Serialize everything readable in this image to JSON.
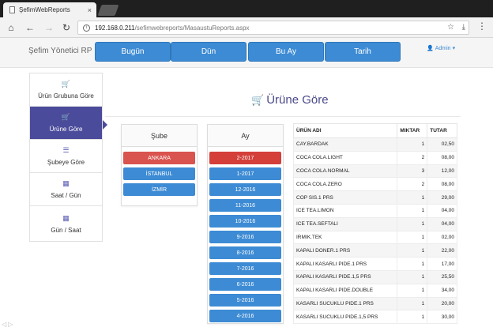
{
  "browser": {
    "tab_title": "ŞefimWebReports",
    "tab_close": "×",
    "url_host": "192.168.0.211",
    "url_path": "/sefimwebreports/MasaustuReports.aspx"
  },
  "navbar": {
    "brand": "Şefim Yönetici RP",
    "buttons": [
      "Bugün",
      "Dün",
      "Bu Ay",
      "Tarih"
    ],
    "user": "Admin"
  },
  "sidebar": {
    "items": [
      {
        "label": "Ürün Grubuna Göre",
        "icon": "cart-icon"
      },
      {
        "label": "Ürüne Göre",
        "icon": "cart-icon",
        "active": true
      },
      {
        "label": "Şubeye Göre",
        "icon": "list-icon"
      },
      {
        "label": "Saat / Gün",
        "icon": "calendar-icon"
      },
      {
        "label": "Gün / Saat",
        "icon": "calendar-icon"
      }
    ]
  },
  "page": {
    "title": "Ürüne Göre"
  },
  "sube_panel": {
    "header": "Şube",
    "items": [
      "ANKARA",
      "İSTANBUL",
      "İZMİR"
    ]
  },
  "ay_panel": {
    "header": "Ay",
    "items": [
      "2-2017",
      "1-2017",
      "12-2016",
      "11-2016",
      "10-2016",
      "9-2016",
      "8-2016",
      "7-2016",
      "6-2016",
      "5-2016",
      "4-2016"
    ]
  },
  "report": {
    "columns": [
      "ÜRÜN ADI",
      "MIKTAR",
      "TUTAR"
    ],
    "rows": [
      [
        "CAY.BARDAK",
        "1",
        "02,50"
      ],
      [
        "COCA COLA.LIGHT",
        "2",
        "08,00"
      ],
      [
        "COCA COLA.NORMAL",
        "3",
        "12,00"
      ],
      [
        "COCA COLA.ZERO",
        "2",
        "08,00"
      ],
      [
        "COP SIS.1 PRS",
        "1",
        "29,00"
      ],
      [
        "ICE TEA.LIMON",
        "1",
        "04,00"
      ],
      [
        "ICE TEA.SEFTALI",
        "1",
        "04,00"
      ],
      [
        "IRMIK.TEK",
        "1",
        "02,00"
      ],
      [
        "KAPALI DONER.1 PRS",
        "1",
        "22,00"
      ],
      [
        "KAPALI KASARLI PIDE.1 PRS",
        "1",
        "17,00"
      ],
      [
        "KAPALI KASARLI PIDE.1,5 PRS",
        "1",
        "25,50"
      ],
      [
        "KAPALI KASARLI PIDE.DOUBLE",
        "1",
        "34,00"
      ],
      [
        "KASARLI SUCUKLU PIDE.1 PRS",
        "1",
        "20,00"
      ],
      [
        "KASARLI SUCUKLU PIDE.1,5 PRS",
        "1",
        "30,00"
      ]
    ]
  },
  "colors": {
    "primary": "#3d8bd4",
    "danger": "#d9534f",
    "accent": "#4b4b9c"
  }
}
